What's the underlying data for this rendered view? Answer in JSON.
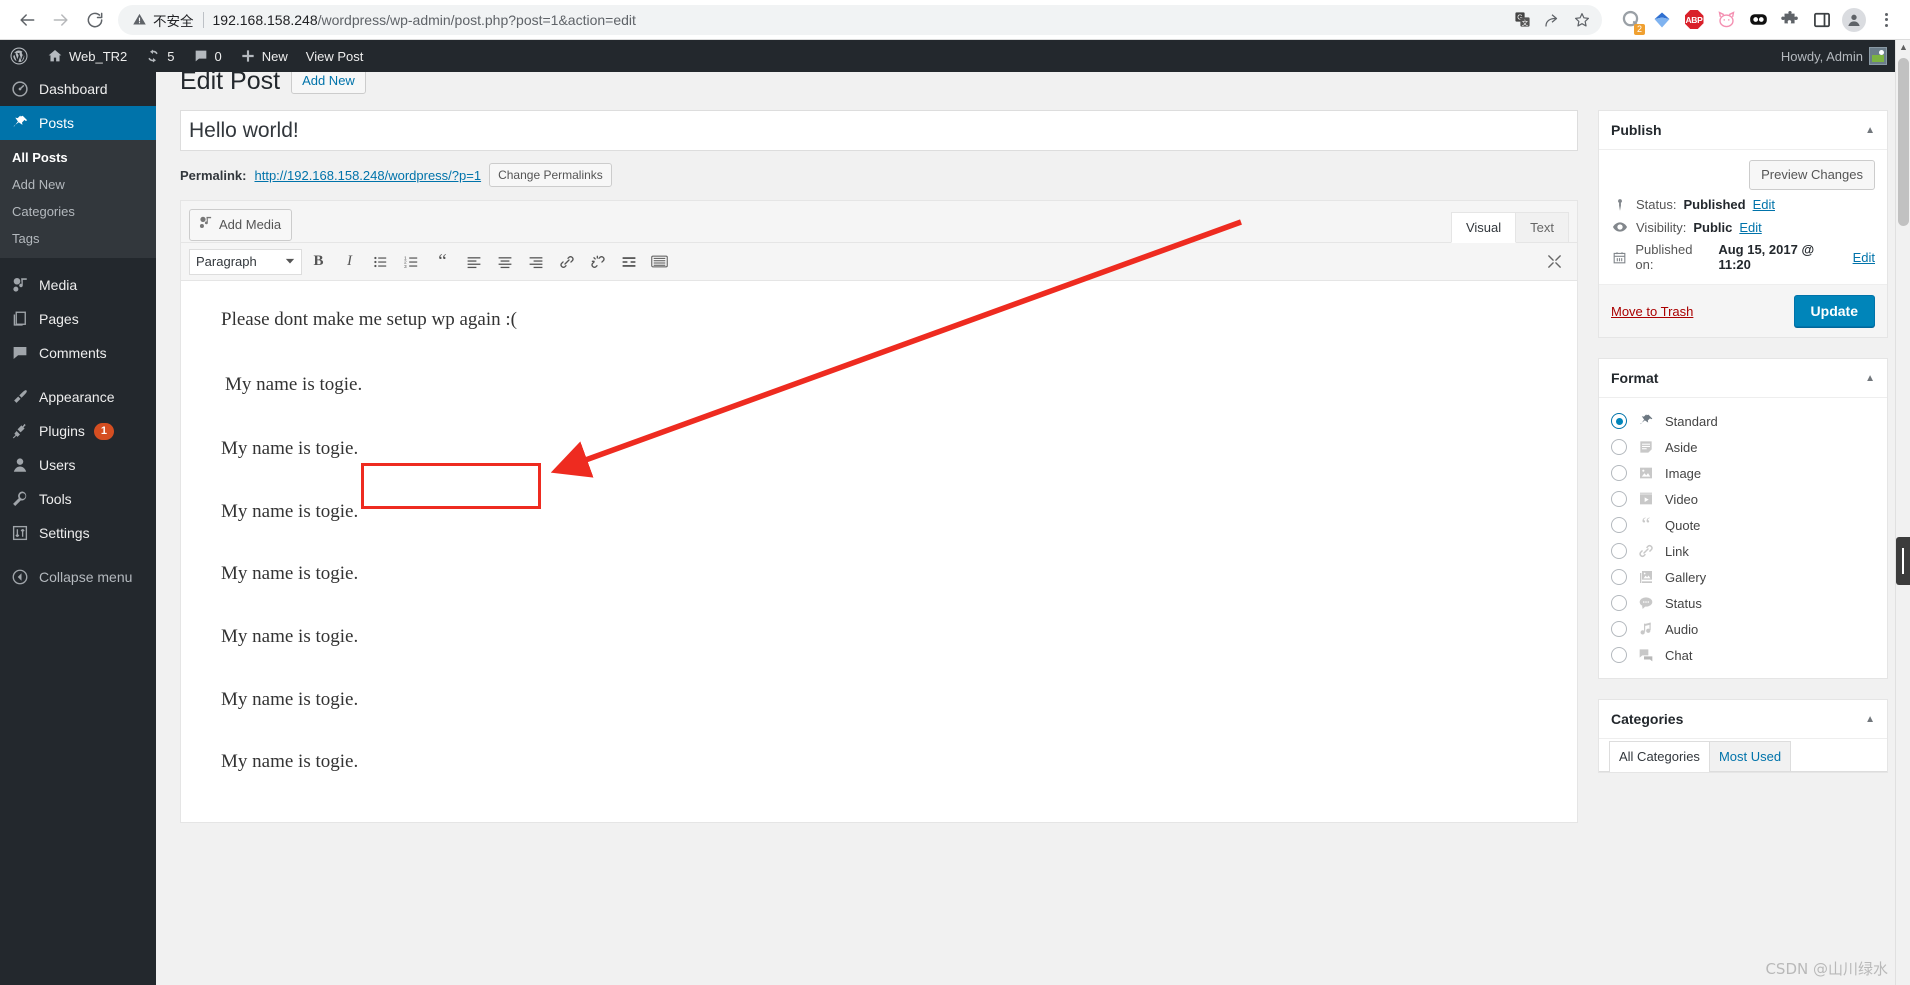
{
  "browser": {
    "back_icon": "back-arrow-icon",
    "forward_icon": "forward-arrow-icon",
    "reload_icon": "reload-icon",
    "security_label": "不安全",
    "security_icon": "warning-triangle-icon",
    "url_host": "192.168.158.248",
    "url_path": "/wordpress/wp-admin/post.php?post=1&action=edit",
    "url_full": "192.168.158.248/wordpress/wp-admin/post.php?post=1&action=edit",
    "omnibox_icons": [
      "translate-icon",
      "share-icon",
      "bookmark-star-icon"
    ],
    "extensions": [
      {
        "name": "q-extension-icon",
        "badge": "2"
      },
      {
        "name": "blue-diamond-extension-icon",
        "badge": ""
      },
      {
        "name": "adblock-plus-icon",
        "label": "ABP",
        "badge": ""
      },
      {
        "name": "pink-cat-extension-icon",
        "badge": ""
      },
      {
        "name": "black-eyes-extension-icon",
        "badge": ""
      },
      {
        "name": "puzzle-extensions-icon",
        "badge": ""
      },
      {
        "name": "side-panel-icon",
        "badge": ""
      },
      {
        "name": "profile-avatar-icon",
        "badge": ""
      },
      {
        "name": "chrome-menu-icon",
        "badge": ""
      }
    ]
  },
  "adminbar": {
    "wp_logo": "wordpress-logo-icon",
    "site_name": "Web_TR2",
    "site_icon": "home-icon",
    "updates_icon": "updates-icon",
    "updates_count": "5",
    "comments_icon": "comment-bubble-icon",
    "comments_count": "0",
    "new_icon": "plus-icon",
    "new_label": "New",
    "view_post_label": "View Post",
    "howdy": "Howdy, Admin",
    "avatar_icon": "user-avatar-image"
  },
  "sidebar": {
    "items": [
      {
        "label": "Dashboard",
        "icon": "dashboard-icon",
        "current": false,
        "badge": ""
      },
      {
        "label": "Posts",
        "icon": "pin-icon",
        "current": true,
        "badge": ""
      },
      {
        "label": "Media",
        "icon": "media-icon",
        "current": false,
        "badge": ""
      },
      {
        "label": "Pages",
        "icon": "pages-icon",
        "current": false,
        "badge": ""
      },
      {
        "label": "Comments",
        "icon": "comment-icon",
        "current": false,
        "badge": ""
      },
      {
        "label": "Appearance",
        "icon": "appearance-brush-icon",
        "current": false,
        "badge": ""
      },
      {
        "label": "Plugins",
        "icon": "plugin-plug-icon",
        "current": false,
        "badge": "1"
      },
      {
        "label": "Users",
        "icon": "users-icon",
        "current": false,
        "badge": ""
      },
      {
        "label": "Tools",
        "icon": "tools-wrench-icon",
        "current": false,
        "badge": ""
      },
      {
        "label": "Settings",
        "icon": "settings-sliders-icon",
        "current": false,
        "badge": ""
      }
    ],
    "posts_submenu": [
      {
        "label": "All Posts",
        "current": true
      },
      {
        "label": "Add New",
        "current": false
      },
      {
        "label": "Categories",
        "current": false
      },
      {
        "label": "Tags",
        "current": false
      }
    ],
    "collapse_label": "Collapse menu",
    "collapse_icon": "collapse-arrow-icon"
  },
  "page": {
    "title": "Edit Post",
    "add_new_label": "Add New"
  },
  "post": {
    "title_value": "Hello world!",
    "title_placeholder": "Enter title here",
    "permalink_label": "Permalink:",
    "permalink_url": "http://192.168.158.248/wordpress/?p=1",
    "change_permalinks_label": "Change Permalinks"
  },
  "editor": {
    "add_media_label": "Add Media",
    "add_media_icon": "add-media-icon",
    "tabs": [
      {
        "label": "Visual",
        "active": true
      },
      {
        "label": "Text",
        "active": false
      }
    ],
    "format_select_value": "Paragraph",
    "format_select_icon": "chevron-down-icon",
    "toolbar_buttons": [
      {
        "name": "bold-icon",
        "glyph": "B"
      },
      {
        "name": "italic-icon",
        "glyph": "I"
      },
      {
        "name": "bulleted-list-icon",
        "glyph": ""
      },
      {
        "name": "numbered-list-icon",
        "glyph": ""
      },
      {
        "name": "blockquote-icon",
        "glyph": "“"
      },
      {
        "name": "align-left-icon",
        "glyph": ""
      },
      {
        "name": "align-center-icon",
        "glyph": ""
      },
      {
        "name": "align-right-icon",
        "glyph": ""
      },
      {
        "name": "insert-link-icon",
        "glyph": ""
      },
      {
        "name": "unlink-icon",
        "glyph": ""
      },
      {
        "name": "insert-read-more-icon",
        "glyph": ""
      },
      {
        "name": "toolbar-toggle-icon",
        "glyph": ""
      }
    ],
    "fullscreen_icon": "fullscreen-distraction-free-icon",
    "paragraphs": [
      "Please dont make me setup wp again :(",
      "My name is togie.",
      "My name is togie.",
      "My name is togie.",
      "My name is togie.",
      "My name is togie.",
      "My name is togie.",
      "My name is togie."
    ]
  },
  "annotation": {
    "box_target_index": 1,
    "box_color": "#ee2b20",
    "arrow_color": "#ee2b20"
  },
  "publish_box": {
    "title": "Publish",
    "toggle_icon": "toggle-up-icon",
    "preview_label": "Preview Changes",
    "status_icon": "pin-status-icon",
    "status_label": "Status:",
    "status_value": "Published",
    "status_edit": "Edit",
    "visibility_icon": "eye-icon",
    "visibility_label": "Visibility:",
    "visibility_value": "Public",
    "visibility_edit": "Edit",
    "published_icon": "calendar-icon",
    "published_label": "Published on:",
    "published_value": "Aug 15, 2017 @ 11:20",
    "published_edit": "Edit",
    "trash_label": "Move to Trash",
    "update_label": "Update",
    "accent_color": "#0085ba",
    "trash_color": "#a00"
  },
  "format_box": {
    "title": "Format",
    "toggle_icon": "toggle-up-icon",
    "options": [
      {
        "label": "Standard",
        "icon": "pin-icon",
        "selected": true
      },
      {
        "label": "Aside",
        "icon": "aside-note-icon",
        "selected": false
      },
      {
        "label": "Image",
        "icon": "image-icon",
        "selected": false
      },
      {
        "label": "Video",
        "icon": "video-icon",
        "selected": false
      },
      {
        "label": "Quote",
        "icon": "quote-icon",
        "selected": false
      },
      {
        "label": "Link",
        "icon": "link-icon",
        "selected": false
      },
      {
        "label": "Gallery",
        "icon": "gallery-icon",
        "selected": false
      },
      {
        "label": "Status",
        "icon": "status-bubble-icon",
        "selected": false
      },
      {
        "label": "Audio",
        "icon": "audio-note-icon",
        "selected": false
      },
      {
        "label": "Chat",
        "icon": "chat-icon",
        "selected": false
      }
    ]
  },
  "categories_box": {
    "title": "Categories",
    "toggle_icon": "toggle-up-icon",
    "tabs": [
      {
        "label": "All Categories",
        "active": true
      },
      {
        "label": "Most Used",
        "active": false
      }
    ]
  },
  "watermark": "CSDN @山川绿水"
}
